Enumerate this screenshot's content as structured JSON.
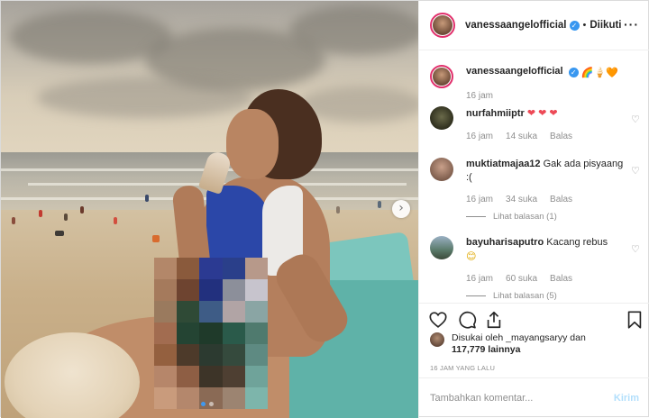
{
  "post": {
    "author": "vanessaangelofficial",
    "follow_status": "Diikuti",
    "caption_emojis": [
      "🌈",
      "🍦",
      "🧡"
    ],
    "caption_time": "16 jam",
    "colors": {
      "accent": "#3897f0",
      "post_button": "#b2dffc",
      "heart_red": "#ed4956",
      "meta_gray": "#8e8e8e"
    }
  },
  "comments": [
    {
      "user": "nurfahmiiptr",
      "text": "",
      "emojis": [
        "❤",
        "❤",
        "❤"
      ],
      "time": "16 jam",
      "likes": "14 suka",
      "reply": "Balas",
      "replies_label": ""
    },
    {
      "user": "muktiatmajaa12",
      "text": "Gak ada pisyaang :(",
      "emojis": [],
      "time": "16 jam",
      "likes": "34 suka",
      "reply": "Balas",
      "replies_label": "Lihat balasan (1)"
    },
    {
      "user": "bayuharisaputro",
      "text": "Kacang rebus",
      "emojis": [
        "😊"
      ],
      "time": "16 jam",
      "likes": "60 suka",
      "reply": "Balas",
      "replies_label": "Lihat balasan (5)"
    }
  ],
  "likes": {
    "line1": "Disukai oleh _mayangsaryy dan",
    "line2": "117,779 lainnya"
  },
  "timestamp": "16 JAM YANG LALU",
  "composer": {
    "placeholder": "Tambahkan komentar...",
    "post_label": "Kirim"
  },
  "icons": {
    "heart": "heart-icon",
    "comment": "comment-icon",
    "share": "share-icon",
    "save": "bookmark-icon",
    "more": "more-options-icon",
    "verified": "verified-icon",
    "next": "chevron-right-icon"
  },
  "carousel": {
    "slides": 2,
    "active_index": 0
  }
}
